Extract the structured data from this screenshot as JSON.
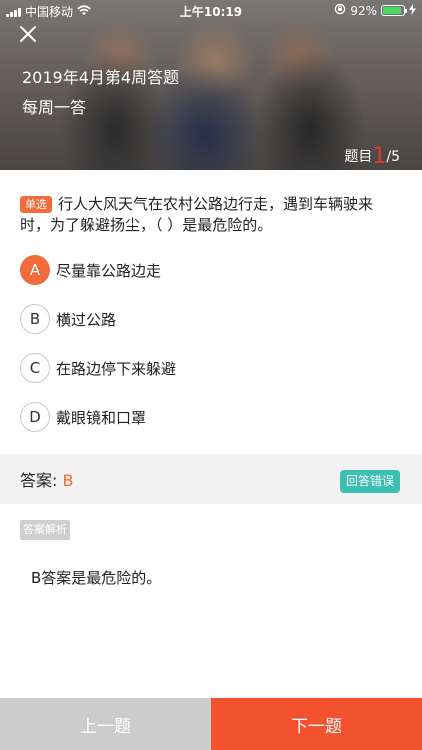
{
  "status_bar": {
    "carrier": "中国移动",
    "time": "上午10:19",
    "battery_percent": "92%",
    "battery_level": 0.92
  },
  "header": {
    "title": "2019年4月第4周答题",
    "subtitle": "每周一答",
    "counter_label": "题目",
    "current": "1",
    "total": "/5"
  },
  "question": {
    "type_tag": "单选",
    "text": "行人大风天气在农村公路边行走，遇到车辆驶来时，为了躲避扬尘，（  ）是最危险的。"
  },
  "options": [
    {
      "letter": "A",
      "text": "尽量靠公路边走",
      "selected": true
    },
    {
      "letter": "B",
      "text": "横过公路",
      "selected": false
    },
    {
      "letter": "C",
      "text": "在路边停下来躲避",
      "selected": false
    },
    {
      "letter": "D",
      "text": "戴眼镜和口罩",
      "selected": false
    }
  ],
  "answer": {
    "label": "答案:",
    "value": "B",
    "result_badge": "回答错误"
  },
  "analysis": {
    "tag": "答案解析",
    "text": "B答案是最危险的。"
  },
  "footer": {
    "prev_label": "上一题",
    "next_label": "下一题"
  },
  "colors": {
    "accent": "#f26b3a",
    "next_button": "#f2522e",
    "prev_button": "#cccccc",
    "badge_teal": "#3bbfb2",
    "counter_red": "#e53935"
  }
}
